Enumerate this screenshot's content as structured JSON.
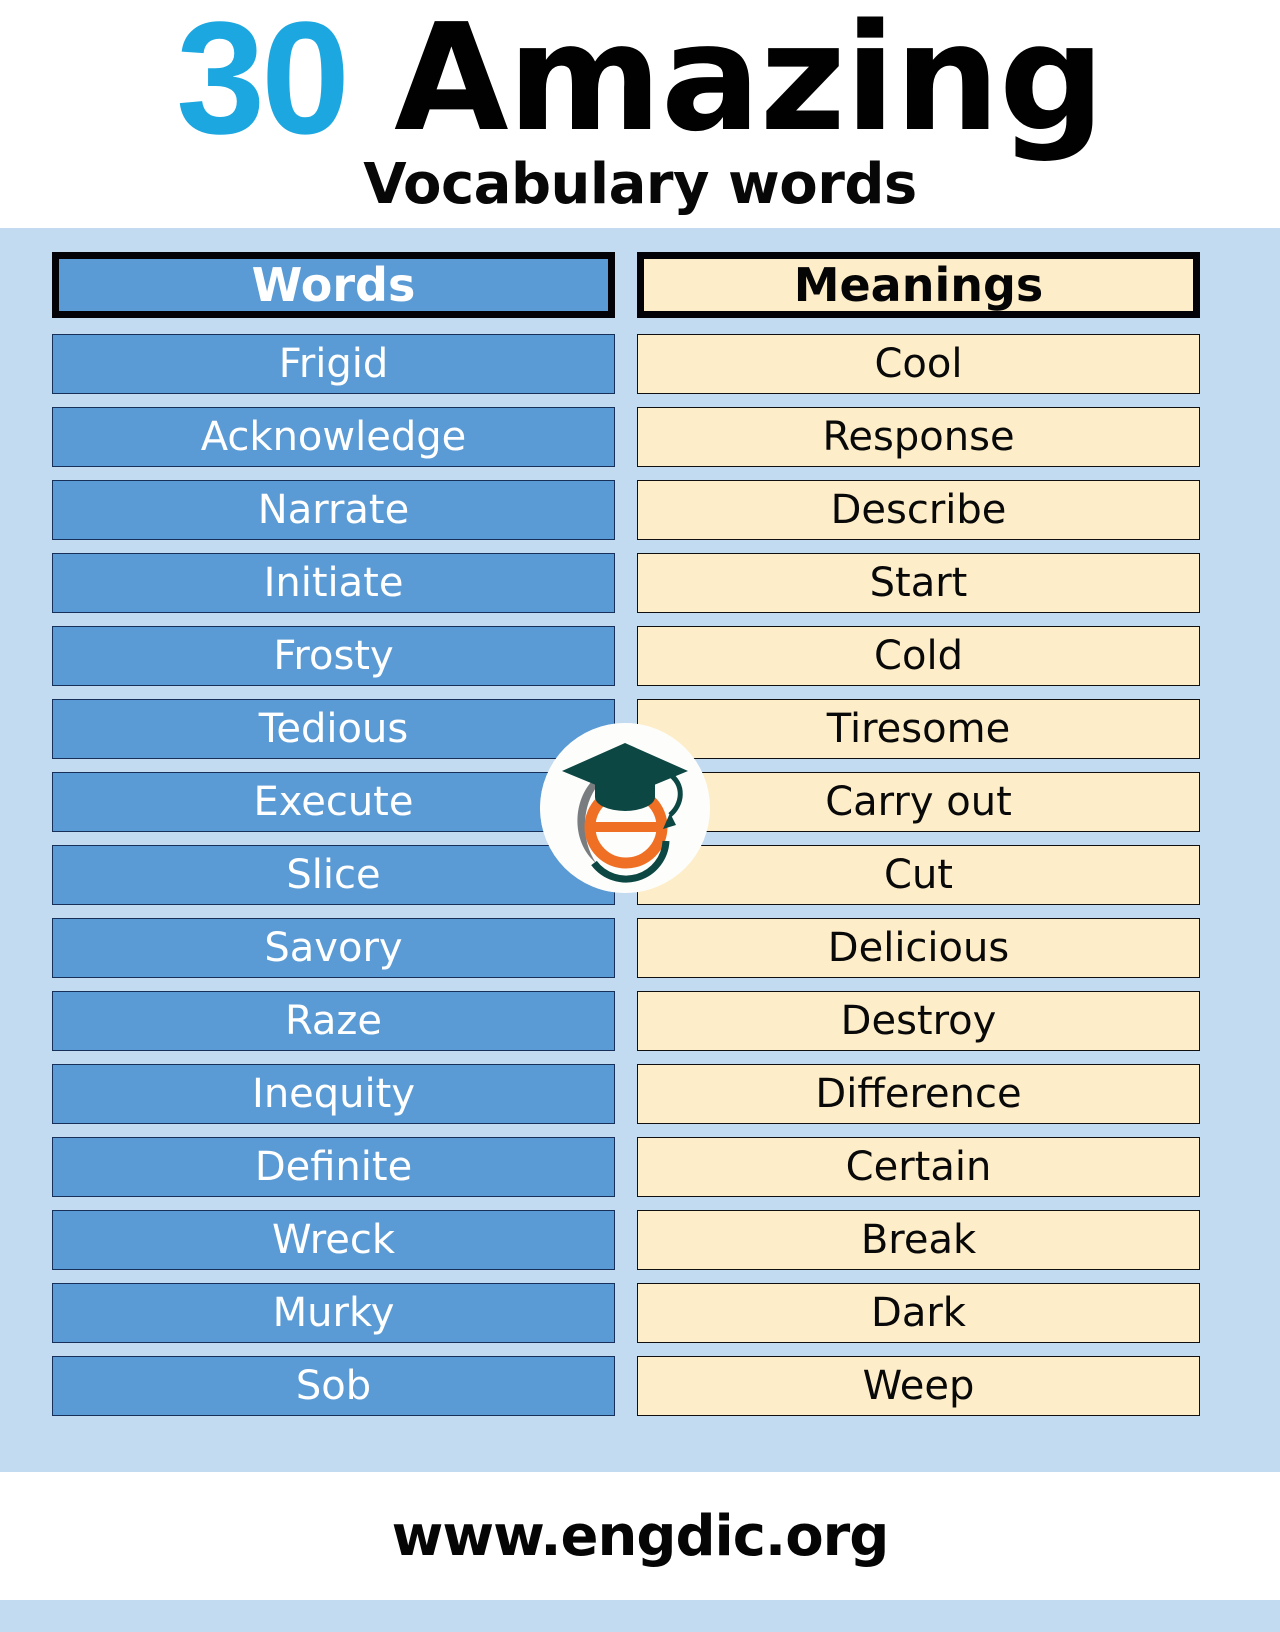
{
  "header": {
    "count": "30",
    "title": "Amazing",
    "subtitle": "Vocabulary words",
    "count_color": "#1CA7E0",
    "title_color": "#010101"
  },
  "table": {
    "columns": [
      {
        "key": "words",
        "label": "Words",
        "bg": "#5b9bd5",
        "text_color": "#ffffff"
      },
      {
        "key": "meanings",
        "label": "Meanings",
        "bg": "#fdeec9",
        "text_color": "#090909"
      }
    ],
    "rows": [
      {
        "word": "Frigid",
        "meaning": "Cool"
      },
      {
        "word": "Acknowledge",
        "meaning": "Response"
      },
      {
        "word": "Narrate",
        "meaning": "Describe"
      },
      {
        "word": "Initiate",
        "meaning": "Start"
      },
      {
        "word": "Frosty",
        "meaning": "Cold"
      },
      {
        "word": "Tedious",
        "meaning": "Tiresome"
      },
      {
        "word": "Execute",
        "meaning": "Carry out"
      },
      {
        "word": "Slice",
        "meaning": "Cut"
      },
      {
        "word": "Savory",
        "meaning": "Delicious"
      },
      {
        "word": "Raze",
        "meaning": "Destroy"
      },
      {
        "word": "Inequity",
        "meaning": "Difference"
      },
      {
        "word": "Definite",
        "meaning": "Certain"
      },
      {
        "word": "Wreck",
        "meaning": "Break"
      },
      {
        "word": "Murky",
        "meaning": "Dark"
      },
      {
        "word": "Sob",
        "meaning": "Weep"
      }
    ]
  },
  "logo": {
    "name": "engdic-graduation-cap-e-logo",
    "cap_color": "#0c4743",
    "e_color": "#ef7024",
    "ring_color": "#7a7d80"
  },
  "footer": {
    "url": "www.engdic.org"
  },
  "colors": {
    "page_background": "#c3dbf0",
    "band_background": "#ffffff",
    "word_cell": "#5b9bd5",
    "meaning_cell": "#fdeec9",
    "header_border": "#020207"
  }
}
